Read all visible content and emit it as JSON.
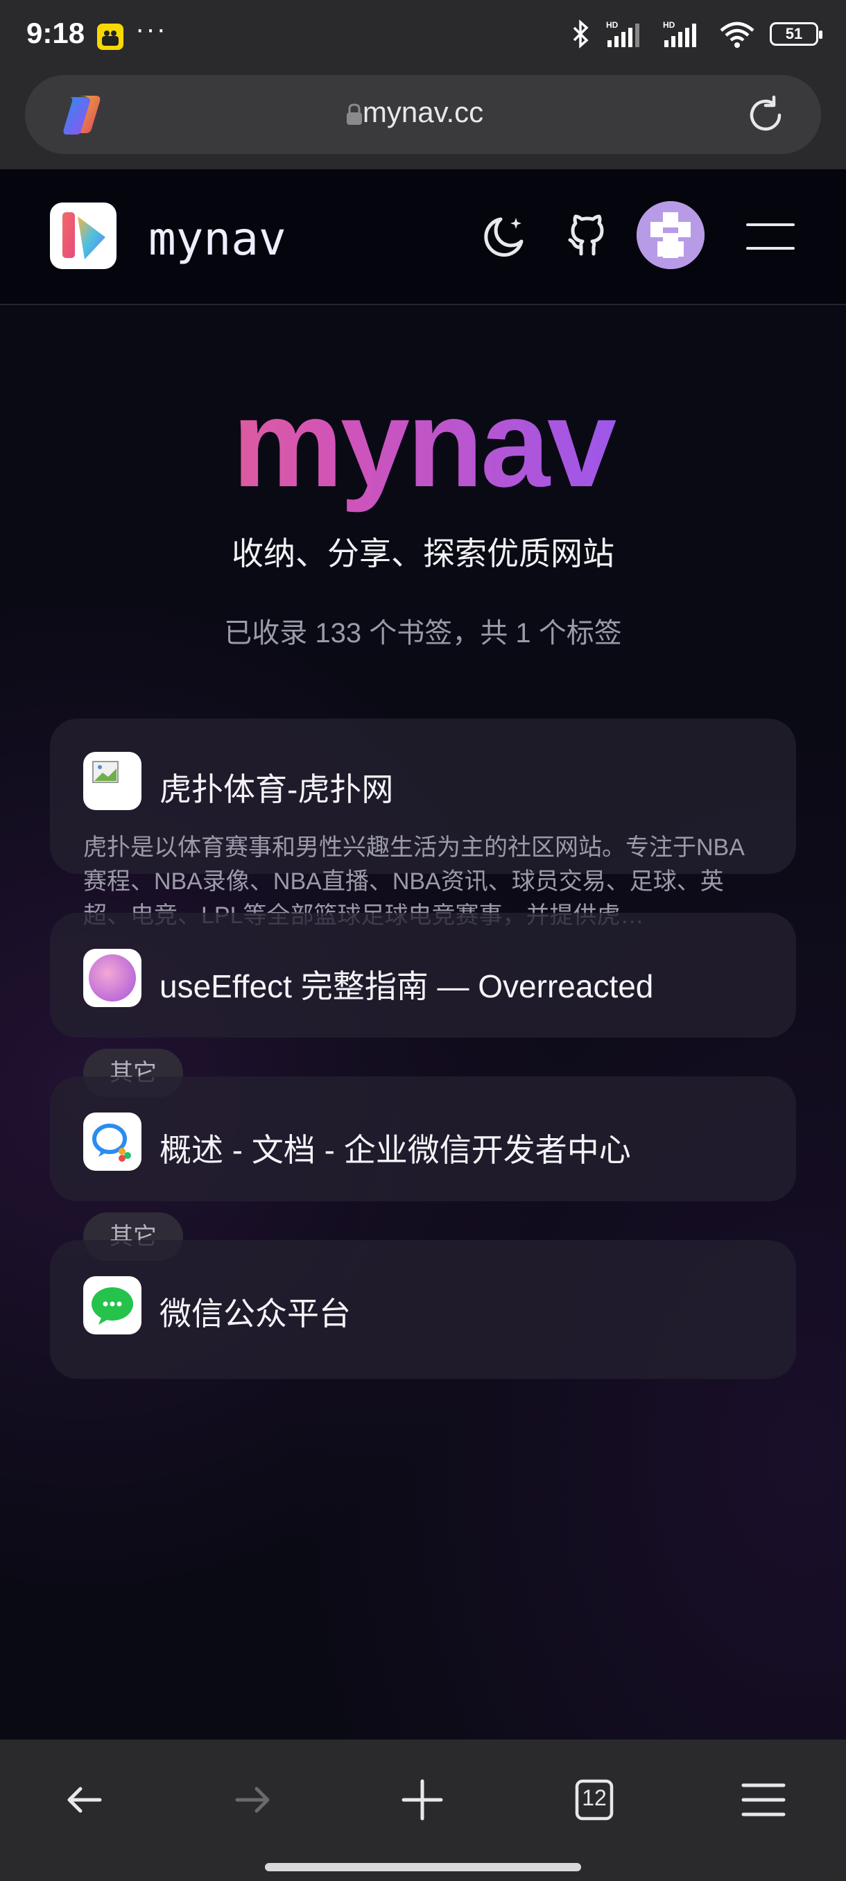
{
  "status_bar": {
    "time": "9:18",
    "more": "···",
    "battery": "51"
  },
  "browser": {
    "url": "mynav.cc",
    "tab_count": "12"
  },
  "site": {
    "name": "mynav"
  },
  "hero": {
    "title": "mynav",
    "subtitle": "收纳、分享、探索优质网站",
    "stats": "已收录 133 个书签，共 1 个标签"
  },
  "cards": [
    {
      "title": "虎扑体育-虎扑网",
      "description": "虎扑是以体育赛事和男性兴趣生活为主的社区网站。专注于NBA赛程、NBA录像、NBA直播、NBA资讯、球员交易、足球、英超、电竞、LPL等全部篮球足球电竞赛事，并提供虎…",
      "favicon": "broken-image-icon"
    },
    {
      "title": "useEffect 完整指南 — Overreacted",
      "tag": "其它",
      "favicon": "gradient-circle-icon"
    },
    {
      "title": "概述 - 文档 - 企业微信开发者中心",
      "tag": "其它",
      "favicon": "wecom-icon"
    },
    {
      "title": "微信公众平台",
      "favicon": "wechat-icon"
    }
  ],
  "colors": {
    "gradient_start": "#f46b6b",
    "gradient_mid": "#d154b8",
    "gradient_end": "#6b63f0",
    "background": "#0a0a14"
  }
}
